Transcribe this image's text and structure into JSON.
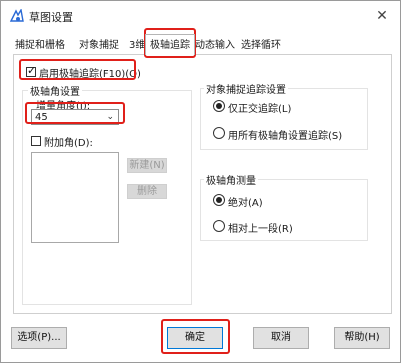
{
  "window": {
    "title": "草图设置",
    "close_glyph": "✕"
  },
  "tabs": [
    {
      "label": "捕捉和栅格"
    },
    {
      "label": "对象捕捉"
    },
    {
      "label": "3维设置"
    },
    {
      "label": "极轴追踪"
    },
    {
      "label": "动态输入"
    },
    {
      "label": "选择循环"
    }
  ],
  "active_tab": "极轴追踪",
  "polar": {
    "enable_label": "启用极轴追踪(F10)(O)",
    "enabled": true,
    "settings_title": "极轴角设置",
    "increment_label": "增量角度(I):",
    "increment_value": "45",
    "additional_label": "附加角(D):",
    "additional_checked": false,
    "new_button": "新建(N)",
    "delete_button": "删除"
  },
  "object_snap_tracking": {
    "title": "对象捕捉追踪设置",
    "options": [
      {
        "label": "仅正交追踪(L)",
        "selected": true
      },
      {
        "label": "用所有极轴角设置追踪(S)",
        "selected": false
      }
    ]
  },
  "angle_measurement": {
    "title": "极轴角测量",
    "options": [
      {
        "label": "绝对(A)",
        "selected": true
      },
      {
        "label": "相对上一段(R)",
        "selected": false
      }
    ]
  },
  "footer": {
    "options_button": "选项(P)...",
    "ok_button": "确定",
    "cancel_button": "取消",
    "help_button": "帮助(H)"
  },
  "highlight_color": "#e0201a"
}
